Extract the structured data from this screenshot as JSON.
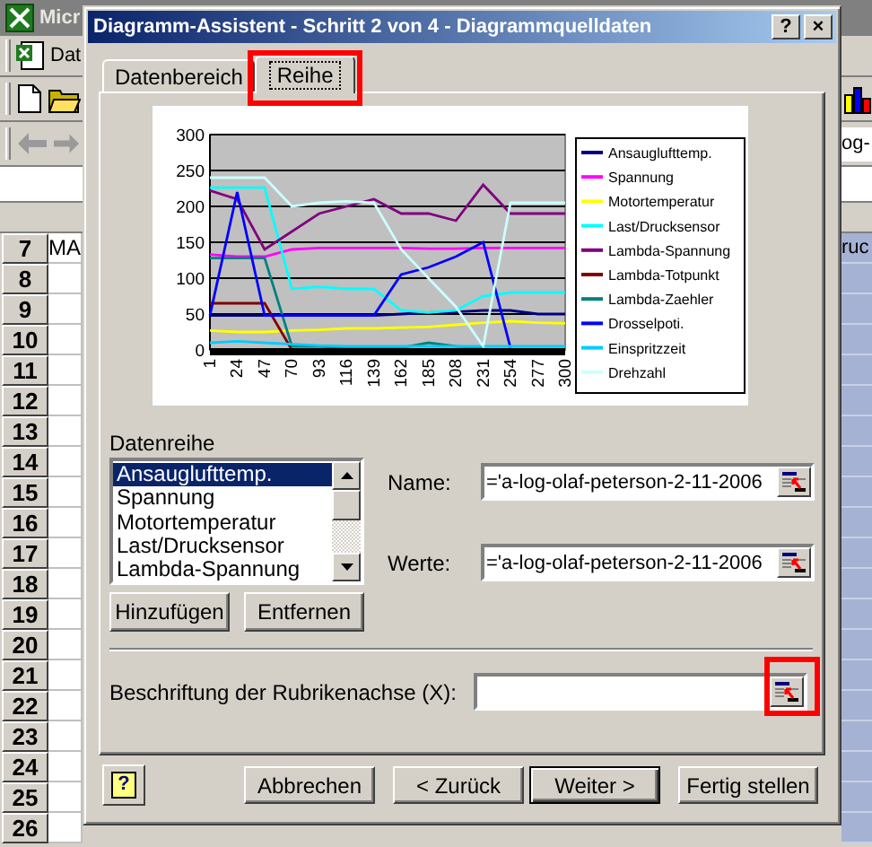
{
  "excel": {
    "title": "Micr",
    "menu": [
      "Dat"
    ],
    "formula_field": "og-",
    "rows": [
      {
        "number": "7",
        "cell": "MA",
        "right_cell": "ruc"
      },
      {
        "number": "8"
      },
      {
        "number": "9"
      },
      {
        "number": "10"
      },
      {
        "number": "11"
      },
      {
        "number": "12"
      },
      {
        "number": "13"
      },
      {
        "number": "14"
      },
      {
        "number": "15"
      },
      {
        "number": "16"
      },
      {
        "number": "17"
      },
      {
        "number": "18"
      },
      {
        "number": "19"
      },
      {
        "number": "20"
      },
      {
        "number": "21"
      },
      {
        "number": "22"
      },
      {
        "number": "23"
      },
      {
        "number": "24"
      },
      {
        "number": "25"
      },
      {
        "number": "26"
      }
    ]
  },
  "dialog": {
    "title": "Diagramm-Assistent - Schritt 2 von 4 - Diagrammquelldaten",
    "title_buttons": [
      "?",
      "×"
    ],
    "tabs": [
      {
        "label": "Datenbereich",
        "selected": false,
        "highlighted": false
      },
      {
        "label": "Reihe",
        "selected": true,
        "highlighted": true
      }
    ],
    "chart_data": {
      "type": "line",
      "x": [
        1,
        24,
        47,
        70,
        93,
        116,
        139,
        162,
        185,
        208,
        231,
        254,
        277,
        300
      ],
      "xticks": [
        1,
        24,
        47,
        70,
        93,
        116,
        139,
        162,
        185,
        208,
        231,
        254,
        277,
        300
      ],
      "xlim": [
        1,
        300
      ],
      "grid": true,
      "legend": true,
      "ylim": [
        0,
        300
      ],
      "yticks": [
        0,
        50,
        100,
        150,
        200,
        250,
        300
      ],
      "series": [
        {
          "name": "Ansauglufttemp.",
          "color": "#000080",
          "values": [
            48,
            48,
            48,
            48,
            48,
            48,
            48,
            50,
            52,
            53,
            55,
            55,
            50,
            50
          ]
        },
        {
          "name": "Spannung",
          "color": "#ff00ff",
          "values": [
            133,
            130,
            130,
            140,
            142,
            142,
            142,
            142,
            141,
            141,
            142,
            142,
            142,
            142
          ]
        },
        {
          "name": "Motortemperatur",
          "color": "#ffff00",
          "values": [
            27,
            25,
            25,
            27,
            28,
            30,
            30,
            31,
            32,
            35,
            38,
            40,
            38,
            37
          ]
        },
        {
          "name": "Last/Drucksensor",
          "color": "#00ffff",
          "values": [
            226,
            226,
            226,
            85,
            88,
            85,
            85,
            55,
            52,
            55,
            75,
            80,
            80,
            80
          ]
        },
        {
          "name": "Lambda-Spannung",
          "color": "#800080",
          "values": [
            222,
            210,
            140,
            165,
            190,
            200,
            210,
            190,
            190,
            180,
            230,
            190,
            190,
            190
          ]
        },
        {
          "name": "Lambda-Totpunkt",
          "color": "#800000",
          "values": [
            65,
            65,
            65,
            0,
            null,
            null,
            null,
            null,
            null,
            null,
            null,
            null,
            null,
            null
          ]
        },
        {
          "name": "Lambda-Zaehler",
          "color": "#008080",
          "values": [
            128,
            128,
            128,
            5,
            5,
            3,
            3,
            3,
            10,
            5,
            3,
            null,
            null,
            null
          ]
        },
        {
          "name": "Drosselpoti.",
          "color": "#0000ff",
          "values": [
            48,
            220,
            48,
            48,
            48,
            48,
            48,
            105,
            115,
            130,
            150,
            3,
            null,
            null
          ]
        },
        {
          "name": "Einspritzzeit",
          "color": "#00ccff",
          "values": [
            10,
            12,
            10,
            8,
            6,
            5,
            5,
            5,
            5,
            5,
            5,
            5,
            5,
            5
          ]
        },
        {
          "name": "Drehzahl",
          "color": "#ccffff",
          "values": [
            240,
            240,
            240,
            200,
            205,
            207,
            205,
            140,
            100,
            60,
            5,
            205,
            205,
            205
          ]
        }
      ]
    },
    "series_label": "Datenreihe",
    "series_list": [
      {
        "label": "Ansauglufttemp.",
        "selected": true
      },
      {
        "label": "Spannung",
        "selected": false
      },
      {
        "label": "Motortemperatur",
        "selected": false
      },
      {
        "label": "Last/Drucksensor",
        "selected": false
      },
      {
        "label": "Lambda-Spannung",
        "selected": false
      }
    ],
    "list_buttons": [
      "Hinzufügen",
      "Entfernen"
    ],
    "fields": [
      {
        "label": "Name:",
        "value": "='a-log-olaf-peterson-2-11-2006",
        "highlighted": false
      },
      {
        "label": "Werte:",
        "value": "='a-log-olaf-peterson-2-11-2006",
        "highlighted": false
      }
    ],
    "category_field": {
      "label": "Beschriftung der Rubrikenachse (X):",
      "highlighted": true
    },
    "help_button": "?",
    "buttons": [
      {
        "label": "Abbrechen",
        "default": false
      },
      {
        "label": "< Zurück",
        "default": false
      },
      {
        "label": "Weiter >",
        "default": true
      },
      {
        "label": "Fertig stellen",
        "default": false
      }
    ]
  }
}
